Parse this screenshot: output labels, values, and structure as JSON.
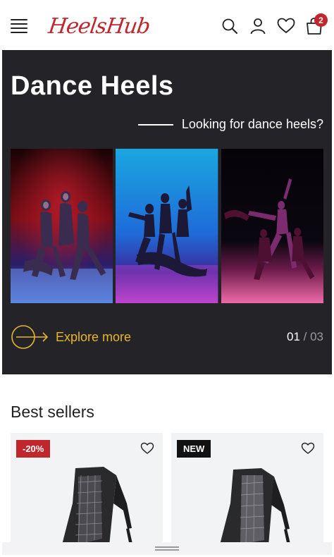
{
  "header": {
    "logo_text": "HeelsHub",
    "cart_count": "2",
    "icons": [
      "menu-icon",
      "search-icon",
      "account-icon",
      "heart-icon",
      "cart-icon"
    ]
  },
  "hero": {
    "title": "Dance Heels",
    "subtitle": "Looking for dance heels?",
    "explore_label": "Explore more",
    "slide_current": "01",
    "slide_separator": " / ",
    "slide_total": "03"
  },
  "best_sellers": {
    "title": "Best sellers",
    "products": [
      {
        "tag": "-20%"
      },
      {
        "tag": "NEW"
      }
    ]
  },
  "colors": {
    "brand": "#c0262b",
    "hero_bg": "#242428",
    "accent": "#e8b52a"
  }
}
